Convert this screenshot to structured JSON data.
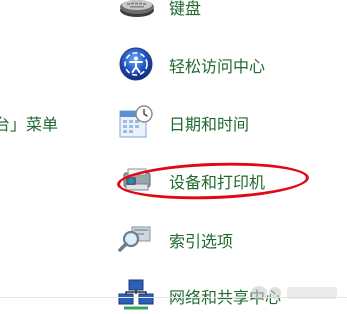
{
  "left_fragment": "台」菜单",
  "items": [
    {
      "label": "键盘",
      "icon": "keyboard-icon"
    },
    {
      "label": "轻松访问中心",
      "icon": "ease-of-access-icon"
    },
    {
      "label": "日期和时间",
      "icon": "calendar-clock-icon"
    },
    {
      "label": "设备和打印机",
      "icon": "printer-camera-icon"
    },
    {
      "label": "索引选项",
      "icon": "magnifier-icon"
    },
    {
      "label": "网络和共享中心",
      "icon": "network-icon"
    }
  ],
  "colors": {
    "link_text": "#1f6a2f",
    "highlight": "#e30613"
  }
}
